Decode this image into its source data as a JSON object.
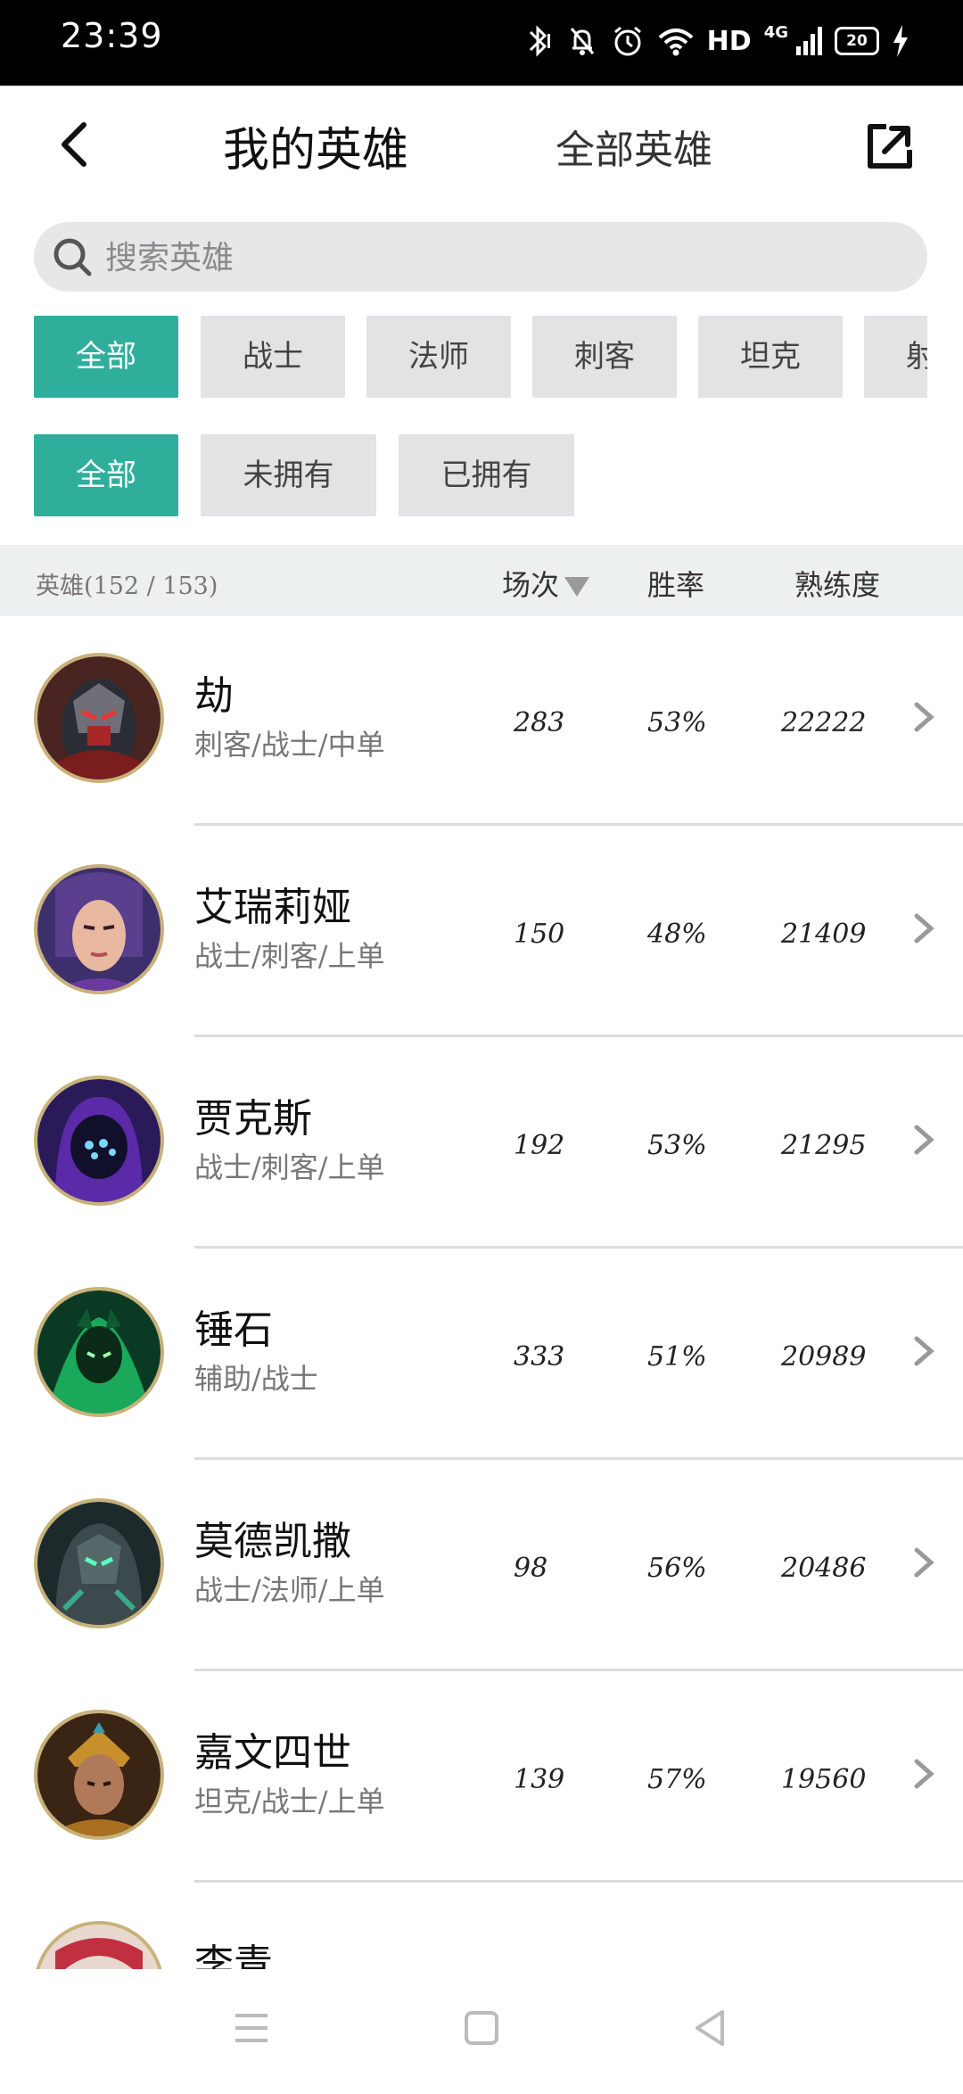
{
  "status": {
    "time": "23:39",
    "hd": "HD",
    "network": "4G",
    "battery": "20"
  },
  "header": {
    "tab_mine": "我的英雄",
    "tab_all": "全部英雄"
  },
  "search": {
    "placeholder": "搜索英雄"
  },
  "role_filters": [
    "全部",
    "战士",
    "法师",
    "刺客",
    "坦克",
    "射手"
  ],
  "role_selected": 0,
  "own_filters": [
    "全部",
    "未拥有",
    "已拥有"
  ],
  "own_selected": 0,
  "list_header": {
    "hero": "英雄(152 / 153)",
    "games": "场次",
    "winrate": "胜率",
    "mastery": "熟练度"
  },
  "heroes": [
    {
      "name": "劫",
      "roles": "刺客/战士/中单",
      "games": "283",
      "winrate": "53%",
      "mastery": "22222"
    },
    {
      "name": "艾瑞莉娅",
      "roles": "战士/刺客/上单",
      "games": "150",
      "winrate": "48%",
      "mastery": "21409"
    },
    {
      "name": "贾克斯",
      "roles": "战士/刺客/上单",
      "games": "192",
      "winrate": "53%",
      "mastery": "21295"
    },
    {
      "name": "锤石",
      "roles": "辅助/战士",
      "games": "333",
      "winrate": "51%",
      "mastery": "20989"
    },
    {
      "name": "莫德凯撒",
      "roles": "战士/法师/上单",
      "games": "98",
      "winrate": "56%",
      "mastery": "20486"
    },
    {
      "name": "嘉文四世",
      "roles": "坦克/战士/上单",
      "games": "139",
      "winrate": "57%",
      "mastery": "19560"
    },
    {
      "name": "李青",
      "roles": "",
      "games": "",
      "winrate": "",
      "mastery": ""
    }
  ],
  "colors": {
    "accent": "#2fae9c",
    "chip_bg": "#e3e3e6",
    "avatar_ring": "#c8b27a"
  }
}
